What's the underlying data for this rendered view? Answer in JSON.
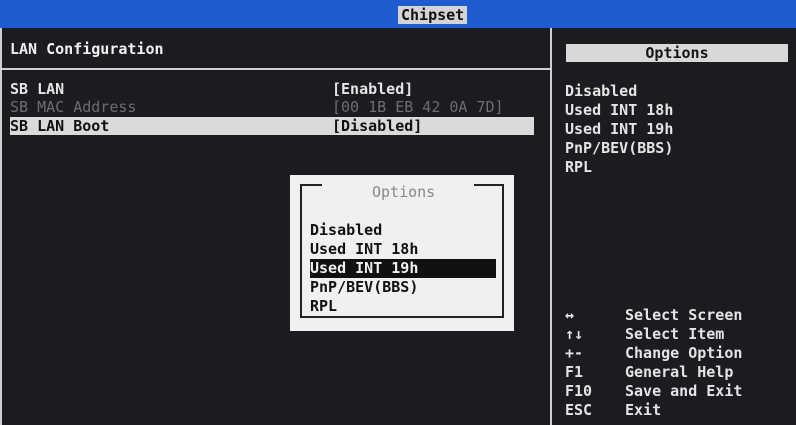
{
  "header": {
    "title": "Chipset"
  },
  "left": {
    "section_title": "LAN Configuration",
    "rows": [
      {
        "label": "SB LAN",
        "value": "[Enabled]"
      },
      {
        "label": "SB MAC Address",
        "value": "[00 1B EB 42 0A 7D]"
      },
      {
        "label": "SB LAN Boot",
        "value": "[Disabled]"
      }
    ]
  },
  "right": {
    "options_header": "Options",
    "options": [
      "Disabled",
      "Used INT 18h",
      "Used INT 19h",
      "PnP/BEV(BBS)",
      "RPL"
    ],
    "keys": [
      {
        "key": "↔",
        "desc": "Select Screen"
      },
      {
        "key": "↑↓",
        "desc": "Select Item"
      },
      {
        "key": "+-",
        "desc": "Change Option"
      },
      {
        "key": "F1",
        "desc": "General Help"
      },
      {
        "key": "F10",
        "desc": "Save and Exit"
      },
      {
        "key": "ESC",
        "desc": "Exit"
      }
    ]
  },
  "popup": {
    "title": "Options",
    "items": [
      "Disabled",
      "Used INT 18h",
      "Used INT 19h",
      "PnP/BEV(BBS)",
      "RPL"
    ],
    "selected": "Used INT 19h"
  },
  "colors": {
    "topbar": "#1f5bd1",
    "background": "#1b1c20",
    "highlight": "#dadada"
  }
}
